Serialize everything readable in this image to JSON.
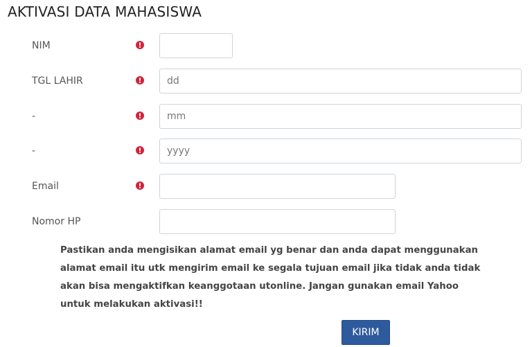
{
  "page": {
    "title": "AKTIVASI DATA MAHASISWA"
  },
  "form": {
    "nim": {
      "label": "NIM",
      "value": "",
      "placeholder": ""
    },
    "tgl_lahir_day": {
      "label": "TGL LAHIR",
      "value": "",
      "placeholder": "dd"
    },
    "tgl_lahir_month": {
      "label": "-",
      "value": "",
      "placeholder": "mm"
    },
    "tgl_lahir_year": {
      "label": "-",
      "value": "",
      "placeholder": "yyyy"
    },
    "email": {
      "label": "Email",
      "value": "",
      "placeholder": ""
    },
    "nomor_hp": {
      "label": "Nomor HP",
      "value": "",
      "placeholder": ""
    }
  },
  "notice": "Pastikan anda mengisikan alamat email yg benar dan anda dapat menggunakan alamat email itu utk mengirim email ke segala tujuan email jika tidak anda tidak akan bisa mengaktifkan keanggotaan utonline. Jangan gunakan email Yahoo untuk melakukan aktivasi!!",
  "buttons": {
    "submit_label": "KIRIM"
  },
  "colors": {
    "required_icon": "#d0243b",
    "primary_button": "#2e5b9e"
  },
  "icons": {
    "required": "exclamation-circle-icon"
  }
}
